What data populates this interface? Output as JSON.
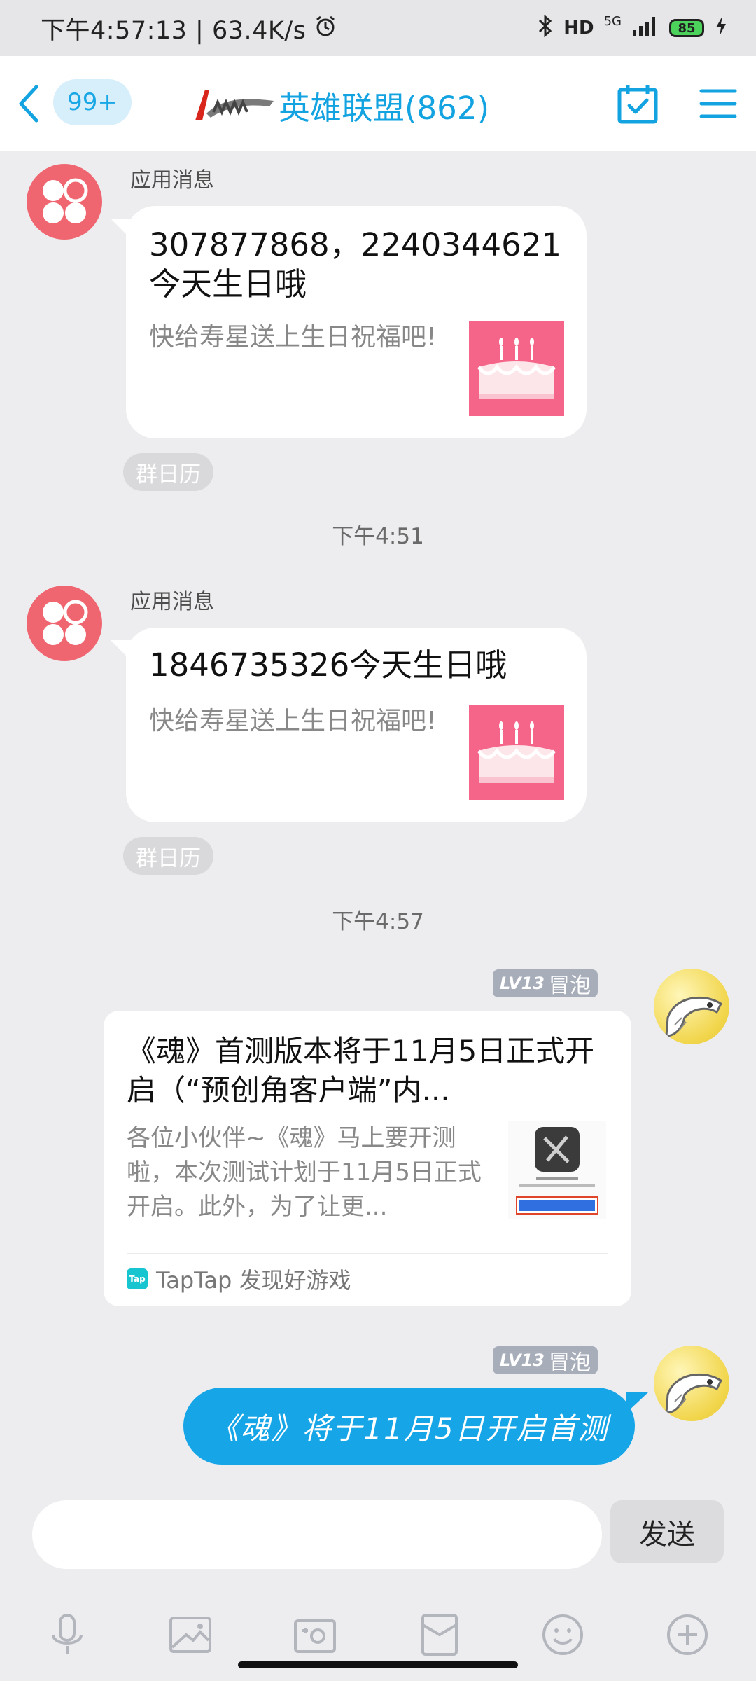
{
  "status_bar": {
    "time": "下午4:57:13 | 63.4K/s",
    "network": "5G",
    "battery": "85"
  },
  "header": {
    "unread_badge": "99+",
    "group_title": "英雄联盟(862)"
  },
  "messages": [
    {
      "sender": "应用消息",
      "title": "307877868，2240344621今天生日哦",
      "subtitle": "快给寿星送上生日祝福吧!",
      "tag": "群日历"
    },
    {
      "time_separator": "下午4:51"
    },
    {
      "sender": "应用消息",
      "title": "1846735326今天生日哦",
      "subtitle": "快给寿星送上生日祝福吧!",
      "tag": "群日历"
    },
    {
      "time_separator": "下午4:57"
    }
  ],
  "outgoing": [
    {
      "level": "LV13",
      "rank": "冒泡",
      "share": {
        "title": "《魂》首测版本将于11月5日正式开启（“预创角客户端”内...",
        "description": "各位小伙伴~《魂》马上要开测啦，本次测试计划于11月5日正式开启。此外，为了让更...",
        "source_icon": "Tap",
        "source": "TapTap 发现好游戏"
      }
    },
    {
      "level": "LV13",
      "rank": "冒泡",
      "text": "《魂》将于11月5日开启首测"
    }
  ],
  "input": {
    "placeholder": "",
    "send_label": "发送"
  },
  "colors": {
    "accent": "#13a3e1",
    "bubble": "#16a5e6",
    "app_avatar": "#ef6670",
    "cake": "#f5658a"
  }
}
